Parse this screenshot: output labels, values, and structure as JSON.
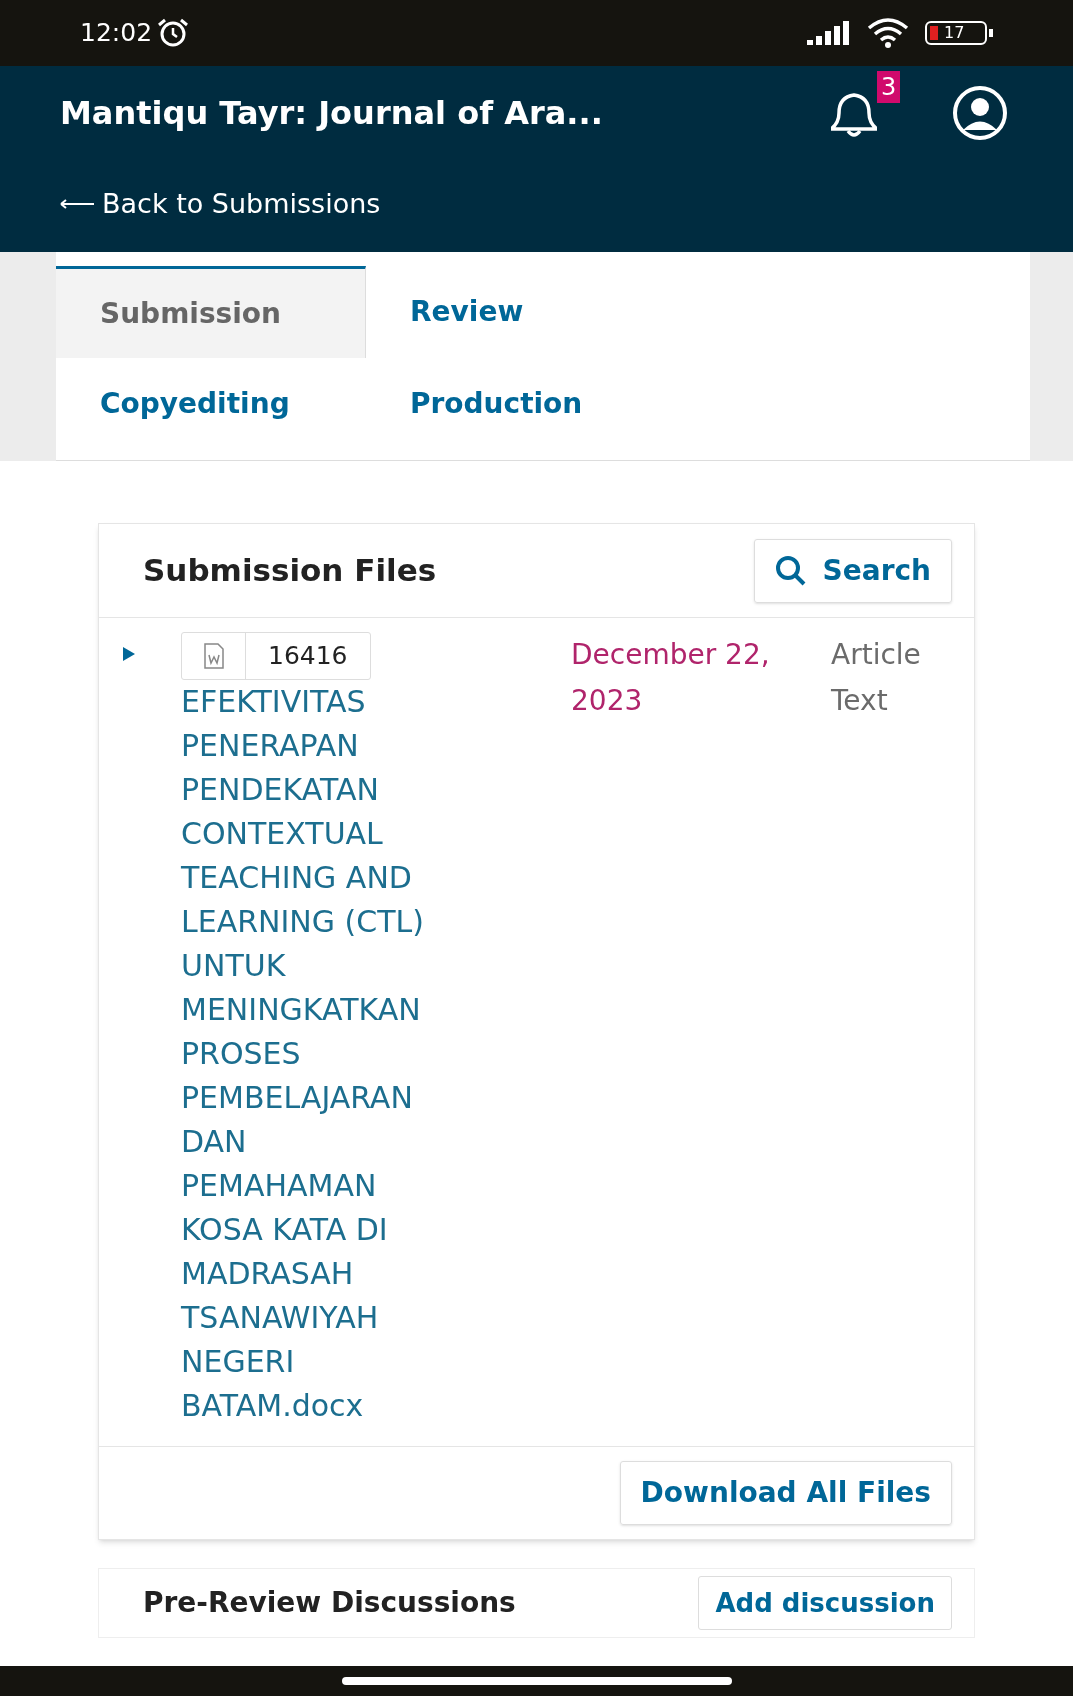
{
  "status_bar": {
    "time": "12:02",
    "battery": "17"
  },
  "header": {
    "title": "Mantiqu Tayr: Journal of Ara...",
    "notifications": "3",
    "back_link": "Back to Submissions"
  },
  "tabs": [
    {
      "label": "Submission",
      "selected": true
    },
    {
      "label": "Review",
      "selected": false
    },
    {
      "label": "Copyediting",
      "selected": false
    },
    {
      "label": "Production",
      "selected": false
    }
  ],
  "submission_files": {
    "title": "Submission Files",
    "search_button": "Search",
    "files": [
      {
        "id": "16416",
        "name": "EFEKTIVITAS PENERAPAN PENDEKATAN CONTEXTUAL TEACHING AND LEARNING (CTL) UNTUK MENINGKATKAN PROSES PEMBELAJARAN DAN PEMAHAMAN KOSA KATA DI MADRASAH TSANAWIYAH NEGERI BATAM.docx",
        "date": "December 22, 2023",
        "type": "Article Text",
        "expanded": false
      }
    ],
    "download_button": "Download All Files"
  },
  "discussions": {
    "title": "Pre-Review Discussions",
    "add_button": "Add discussion"
  }
}
